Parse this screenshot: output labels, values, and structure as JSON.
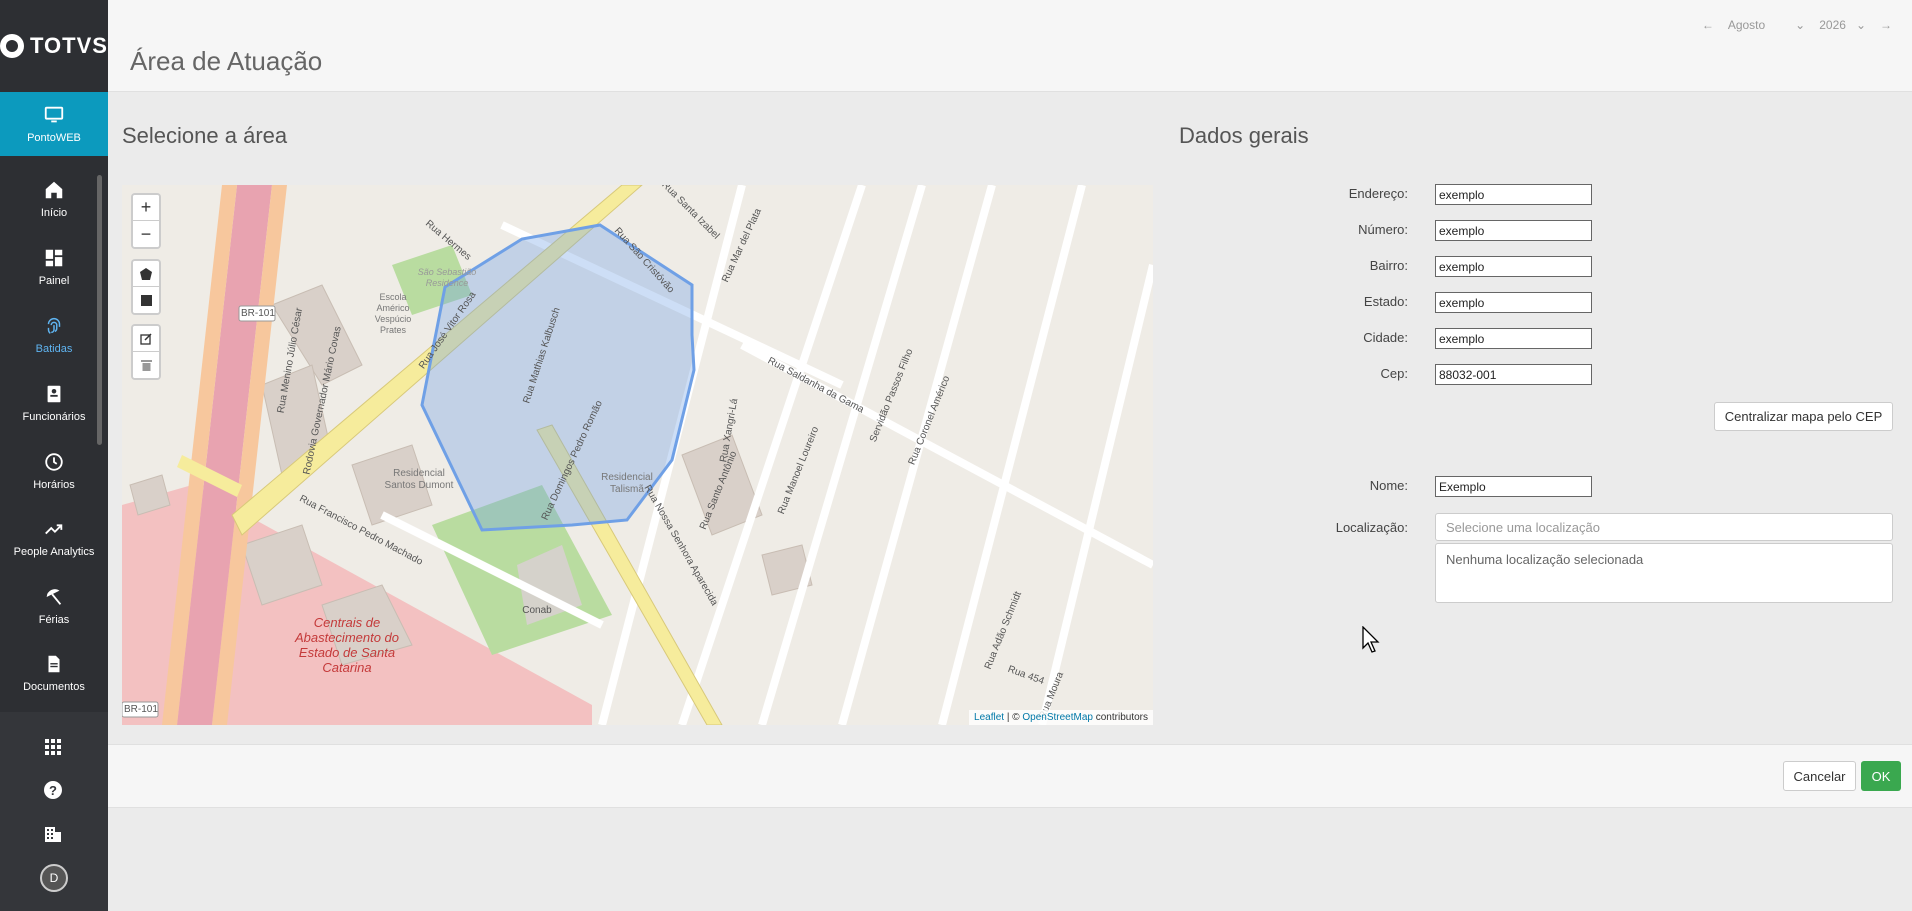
{
  "app": {
    "logo_text": "TOTVS",
    "page_title": "Área de Atuação"
  },
  "sidebar": {
    "items": [
      {
        "label": "PontoWEB",
        "icon": "monitor-icon",
        "active": true
      },
      {
        "label": "Início",
        "icon": "home-icon"
      },
      {
        "label": "Painel",
        "icon": "dashboard-icon"
      },
      {
        "label": "Batidas",
        "icon": "fingerprint-icon"
      },
      {
        "label": "Funcionários",
        "icon": "badge-icon"
      },
      {
        "label": "Horários",
        "icon": "clock-icon"
      },
      {
        "label": "People Analytics",
        "icon": "trending-icon"
      },
      {
        "label": "Férias",
        "icon": "beach-umbrella-icon"
      },
      {
        "label": "Documentos",
        "icon": "document-icon"
      }
    ],
    "bottom_icons": [
      "apps-grid-icon",
      "help-icon",
      "building-icon"
    ],
    "avatar_initial": "D"
  },
  "period": {
    "month": "Agosto",
    "year": "2026"
  },
  "sections": {
    "map_title": "Selecione a área",
    "form_title": "Dados gerais"
  },
  "map": {
    "attribution_leaflet": "Leaflet",
    "attribution_sep": " | © ",
    "attribution_osm": "OpenStreetMap",
    "attribution_rest": " contributors",
    "labels": {
      "br101_a": "BR-101",
      "br101_b": "BR-101",
      "rua_hermes": "Rua Hermes",
      "rua_sao_cristovao": "Rua São Cristóvão",
      "rua_santa_izabel": "Rua Santa Izabel",
      "rua_mar_del_plata": "Rua Mar del Plata",
      "rua_jose_vitor_rosa": "Rua José Vitor Rosa",
      "rua_mathias_kalbusch": "Rua Mathias Kalbusch",
      "rua_domingos_pedro_romao": "Rua Domingos Pedro Romão",
      "rua_francisco_pedro_machado": "Rua Francisco Pedro Machado",
      "rua_nossa_senhora_aparecida": "Rua Nossa Senhora Aparecida",
      "rua_saldanha_da_gama": "Rua Saldanha da Gama",
      "rua_manoel_loureiro": "Rua Manoel Loureiro",
      "servidao_passos_filho": "Servidão Passos Filho",
      "rua_coronel_americo": "Rua Coronel Américo",
      "rua_santo_antonio": "Rua Santo Antônio",
      "rua_xangri_la": "Rua Xangri-Lá",
      "rua_ado_schmidt": "Rua Adão Schmidt",
      "rua_454": "Rua 454",
      "rua_moura": "Rua Moura",
      "rua_menino_julio_cesar": "Rua Menino Júlio César",
      "rodovia_governador": "Rodovia Governador Mário Covas",
      "residencial_santos_dumont": "Residencial Santos Dumont",
      "residencial_talisma": "Residencial Talismã",
      "escola": "Escola Américo Vespúcio Prates",
      "conab": "Conab",
      "centrais": "Centrais de Abastecimento do Estado de Santa Catarina",
      "sao_sebastiao": "São Sebastião Residence"
    }
  },
  "form": {
    "endereco": {
      "label": "Endereço:",
      "value": "exemplo"
    },
    "numero": {
      "label": "Número:",
      "value": "exemplo"
    },
    "bairro": {
      "label": "Bairro:",
      "value": "exemplo"
    },
    "estado": {
      "label": "Estado:",
      "value": "exemplo"
    },
    "cidade": {
      "label": "Cidade:",
      "value": "exemplo"
    },
    "cep": {
      "label": "Cep:",
      "value": "88032-001"
    },
    "center_button": "Centralizar mapa pelo CEP",
    "nome": {
      "label": "Nome:",
      "value": "Exemplo"
    },
    "localizacao": {
      "label": "Localização:",
      "placeholder": "Selecione uma localização",
      "empty_text": "Nenhuma localização selecionada"
    }
  },
  "footer": {
    "cancel": "Cancelar",
    "ok": "OK"
  },
  "colors": {
    "accent": "#0c9abe",
    "ok": "#3aa84f",
    "sidebar": "#2d2f33",
    "polygon": "#6fa0e6"
  }
}
